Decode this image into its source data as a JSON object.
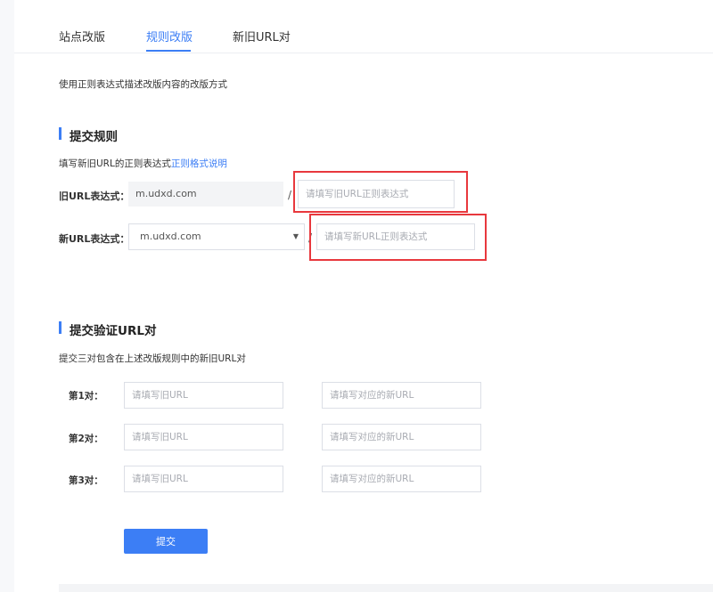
{
  "tabs": [
    {
      "label": "站点改版",
      "active": false
    },
    {
      "label": "规则改版",
      "active": true
    },
    {
      "label": "新旧URL对",
      "active": false
    }
  ],
  "intro": "使用正则表达式描述改版内容的改版方式",
  "rule_section": {
    "title": "提交规则",
    "hint": "填写新旧URL的正则表达式",
    "hint_link": "正则格式说明",
    "old_label": "旧URL表达式：",
    "old_domain": "m.udxd.com",
    "old_placeholder": "请填写旧URL正则表达式",
    "new_label": "新URL表达式：",
    "new_domain": "m.udxd.com",
    "new_placeholder": "请填写新URL正则表达式",
    "separator": "/"
  },
  "verify_section": {
    "title": "提交验证URL对",
    "hint": "提交三对包含在上述改版规则中的新旧URL对",
    "pairs": [
      {
        "label": "第1对：",
        "old_placeholder": "请填写旧URL",
        "new_placeholder": "请填写对应的新URL"
      },
      {
        "label": "第2对：",
        "old_placeholder": "请填写旧URL",
        "new_placeholder": "请填写对应的新URL"
      },
      {
        "label": "第3对：",
        "old_placeholder": "请填写旧URL",
        "new_placeholder": "请填写对应的新URL"
      }
    ]
  },
  "submit_label": "提交",
  "colors": {
    "accent": "#3c7ef5",
    "highlight": "#e8383d"
  }
}
